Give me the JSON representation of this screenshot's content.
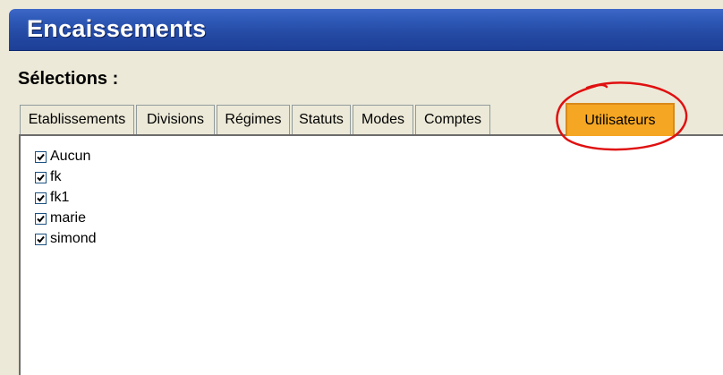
{
  "window": {
    "title": "Encaissements"
  },
  "section_label": "Sélections :",
  "tabs": [
    {
      "label": "Etablissements",
      "active": false
    },
    {
      "label": "Divisions",
      "active": false
    },
    {
      "label": "Régimes",
      "active": false
    },
    {
      "label": "Statuts",
      "active": false
    },
    {
      "label": "Modes",
      "active": false
    },
    {
      "label": "Comptes",
      "active": false
    },
    {
      "label": "Utilisateurs",
      "active": true
    }
  ],
  "users": [
    {
      "label": "Aucun",
      "checked": true
    },
    {
      "label": "fk",
      "checked": true
    },
    {
      "label": "fk1",
      "checked": true
    },
    {
      "label": "marie",
      "checked": true
    },
    {
      "label": "simond",
      "checked": true
    }
  ],
  "colors": {
    "active_tab": "#f5a623",
    "annotation": "#e01010",
    "title_bar": "#2f5ab8"
  }
}
